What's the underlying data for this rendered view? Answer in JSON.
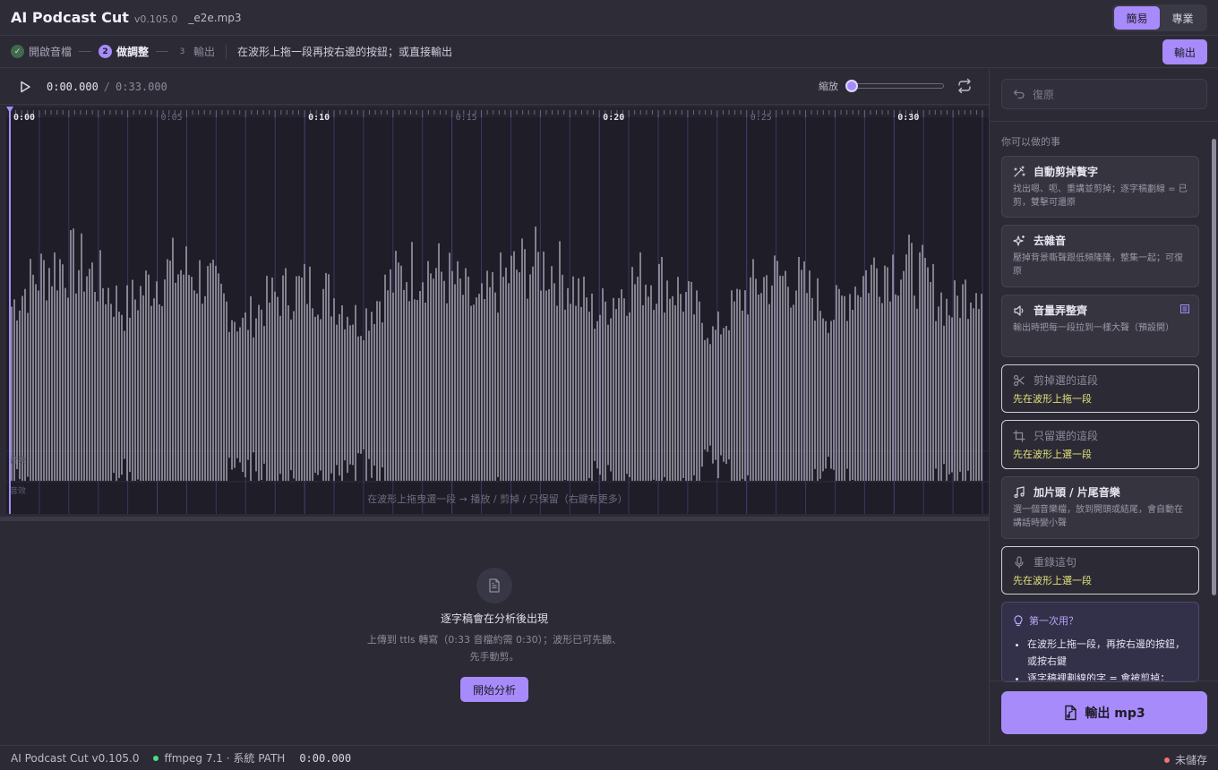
{
  "app": {
    "title": "AI Podcast Cut",
    "version": "v0.105.0",
    "file_name": "_e2e.mp3"
  },
  "mode": {
    "simple_label": "簡易",
    "pro_label": "專業",
    "active": "simple"
  },
  "steps": {
    "items": [
      {
        "badge": "✓",
        "label": "開啟音檔",
        "state": "done"
      },
      {
        "badge": "2",
        "label": "做調整",
        "state": "active"
      },
      {
        "badge": "3",
        "label": "輸出",
        "state": "pending"
      }
    ],
    "hint": "在波形上拖一段再按右邊的按鈕；或直接輸出",
    "export_label": "輸出"
  },
  "transport": {
    "current_time": "0:00.000",
    "separator": "/",
    "total_time": "0:33.000",
    "zoom_label": "縮放",
    "zoom_level": 0
  },
  "waveform": {
    "duration_seconds": 33,
    "tick_labels": [
      "0:00",
      "0:05",
      "0:10",
      "0:15",
      "0:20",
      "0:25",
      "0:30"
    ],
    "lane_labels": [
      "音樂",
      "音效"
    ],
    "hint": "在波形上拖曳選一段 → 播放 / 剪掉 / 只保留（右鍵有更多）"
  },
  "transcript": {
    "title": "逐字稿會在分析後出現",
    "desc_line1": "上傳到 ttls 轉寫（0:33 音檔約需 0:30）；波形已可先聽、",
    "desc_line2": "先手動剪。",
    "analyze_label": "開始分析"
  },
  "panel": {
    "undo_label": "復原",
    "actions_title": "你可以做的事",
    "actions": [
      {
        "icon": "magic-wand-icon",
        "title": "自動剪掉贅字",
        "desc": "找出嗯、呃、重講並剪掉；逐字稿劃線 = 已剪，雙擊可還原",
        "style": "filled"
      },
      {
        "icon": "sparkles-icon",
        "title": "去雜音",
        "desc": "壓掉背景嘶聲跟低頻隆隆，整集一起；可復原",
        "style": "filled"
      },
      {
        "icon": "speaker-icon",
        "title": "音量弄整齊",
        "desc": "輸出時把每一段拉到一樣大聲（預設開）",
        "style": "filled",
        "badge": "開"
      },
      {
        "icon": "scissors-icon",
        "title": "剪掉選的這段",
        "warn": "先在波形上拖一段",
        "style": "outline"
      },
      {
        "icon": "crop-icon",
        "title": "只留選的這段",
        "warn": "先在波形上選一段",
        "style": "outline"
      },
      {
        "icon": "music-note-icon",
        "title": "加片頭 / 片尾音樂",
        "desc": "選一個音樂檔，放到開頭或結尾，會自動在講話時變小聲",
        "style": "filled"
      },
      {
        "icon": "microphone-icon",
        "title": "重錄這句",
        "warn": "先在波形上選一段",
        "style": "outline"
      }
    ],
    "tips": {
      "title": "第一次用？",
      "items": [
        "在波形上拖一段，再按右邊的按鈕，或按右鍵",
        "逐字稿裡劃線的字 = 會被剪掉；"
      ]
    },
    "export_mp3_label": "輸出 mp3"
  },
  "status": {
    "app_version": "AI Podcast Cut v0.105.0",
    "ffmpeg": "ffmpeg 7.1 · 系統 PATH",
    "time": "0:00.000",
    "save_state": "未儲存"
  },
  "colors": {
    "accent": "#a78bfa",
    "waveform": "#b8b6c4",
    "ok": "#4ade80",
    "unsaved": "#f87171",
    "warn_text": "#e4e27a"
  }
}
